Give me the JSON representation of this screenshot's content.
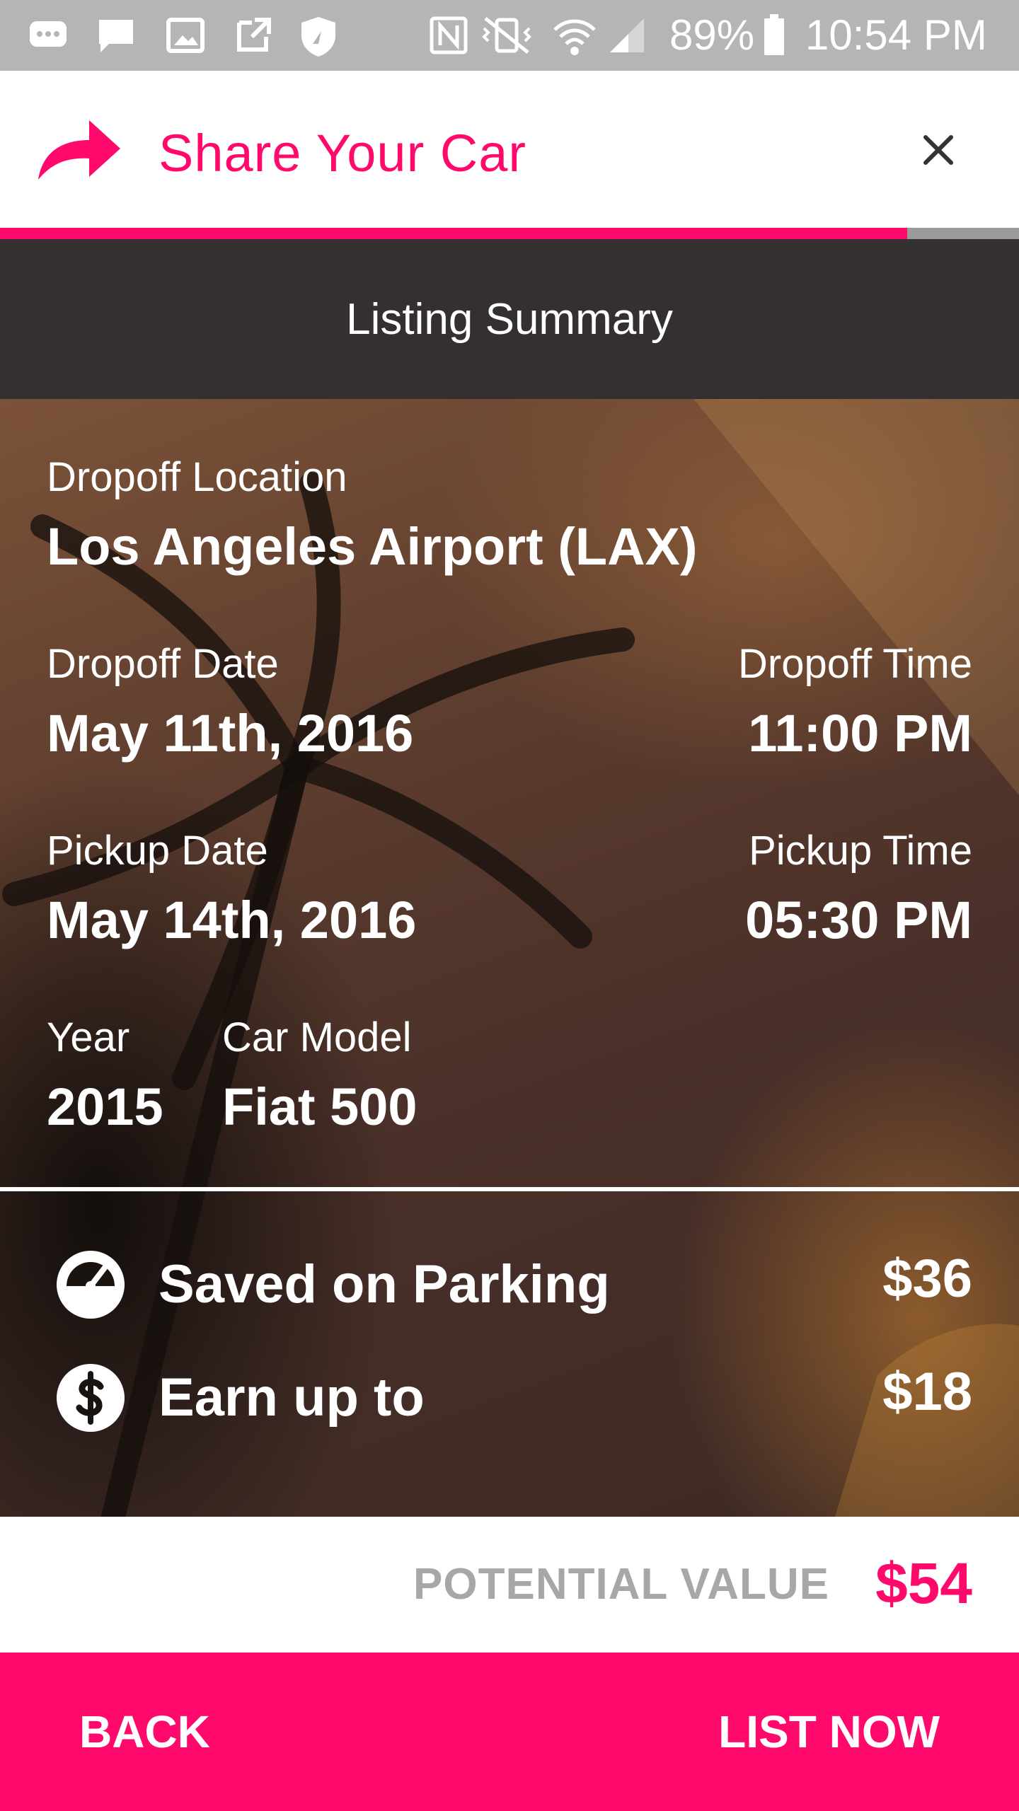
{
  "status_bar": {
    "battery": "89%",
    "time": "10:54 PM"
  },
  "header": {
    "title": "Share Your Car",
    "close_label": "×"
  },
  "progress": {
    "fraction": 0.89
  },
  "summary": {
    "title": "Listing Summary",
    "dropoff_location_label": "Dropoff Location",
    "dropoff_location_value": "Los Angeles Airport (LAX)",
    "dropoff_date_label": "Dropoff Date",
    "dropoff_date_value": "May 11th, 2016",
    "dropoff_time_label": "Dropoff Time",
    "dropoff_time_value": "11:00 PM",
    "pickup_date_label": "Pickup Date",
    "pickup_date_value": "May 14th, 2016",
    "pickup_time_label": "Pickup Time",
    "pickup_time_value": "05:30 PM",
    "year_label": "Year",
    "year_value": "2015",
    "model_label": "Car Model",
    "model_value": "Fiat 500"
  },
  "savings": {
    "parking_label": "Saved on Parking",
    "parking_value": "$36",
    "parking_icon": "speedometer-icon",
    "earn_label": "Earn up to",
    "earn_value": "$18",
    "earn_icon": "dollar-icon"
  },
  "potential": {
    "label": "POTENTIAL VALUE",
    "value": "$54"
  },
  "footer": {
    "back_label": "BACK",
    "list_label": "LIST NOW"
  },
  "colors": {
    "accent": "#ff0a6c",
    "summary_bar": "#34302f",
    "status_bar": "#b5b5b5"
  }
}
